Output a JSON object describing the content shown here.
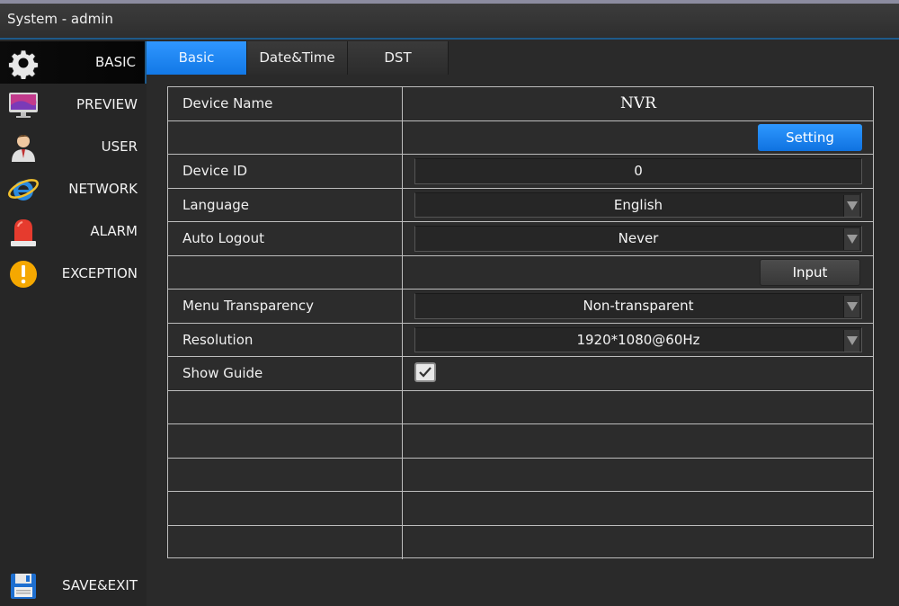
{
  "window": {
    "title": "System - admin"
  },
  "sidebar": {
    "items": [
      {
        "label": "BASIC",
        "icon": "gear-icon",
        "active": true
      },
      {
        "label": "PREVIEW",
        "icon": "monitor-icon",
        "active": false
      },
      {
        "label": "USER",
        "icon": "user-icon",
        "active": false
      },
      {
        "label": "NETWORK",
        "icon": "network-icon",
        "active": false
      },
      {
        "label": "ALARM",
        "icon": "alarm-light-icon",
        "active": false
      },
      {
        "label": "EXCEPTION",
        "icon": "warning-icon",
        "active": false
      }
    ],
    "save_exit": {
      "label": "SAVE&EXIT",
      "icon": "floppy-disk-icon"
    }
  },
  "tabs": [
    {
      "label": "Basic",
      "active": true
    },
    {
      "label": "Date&Time",
      "active": false
    },
    {
      "label": "DST",
      "active": false
    }
  ],
  "form": {
    "device_name": {
      "label": "Device Name",
      "value": "NVR"
    },
    "setting_button": {
      "label": "Setting"
    },
    "device_id": {
      "label": "Device ID",
      "value": "0"
    },
    "language": {
      "label": "Language",
      "value": "English"
    },
    "auto_logout": {
      "label": "Auto Logout",
      "value": "Never"
    },
    "input_button": {
      "label": "Input"
    },
    "menu_transparency": {
      "label": "Menu Transparency",
      "value": "Non-transparent"
    },
    "resolution": {
      "label": "Resolution",
      "value": "1920*1080@60Hz"
    },
    "show_guide": {
      "label": "Show Guide",
      "checked": true
    }
  },
  "colors": {
    "accent": "#1a85f5",
    "background": "#2a2a2a",
    "border": "#bdbdbd"
  }
}
